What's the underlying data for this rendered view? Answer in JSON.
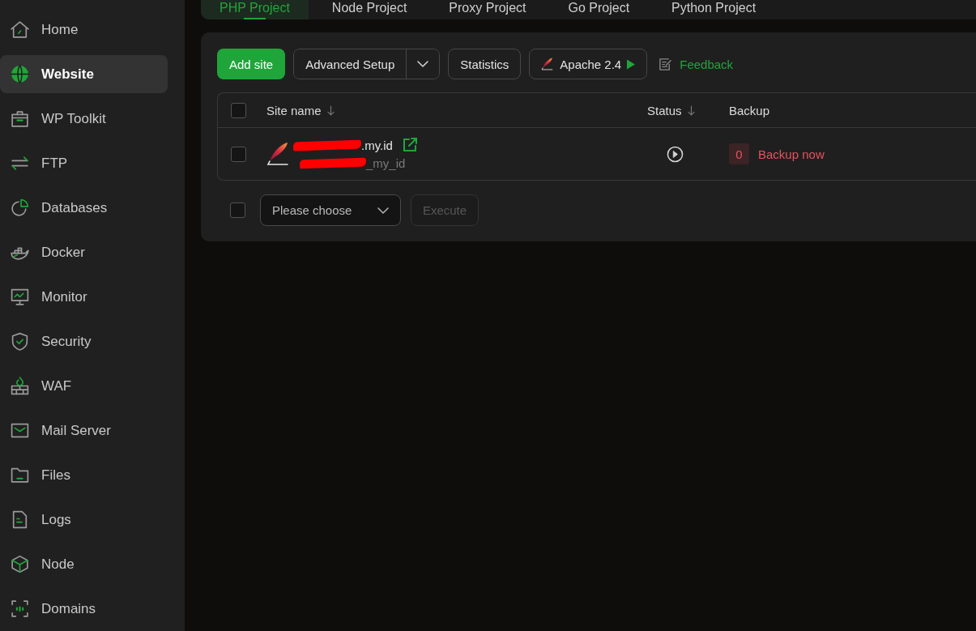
{
  "project_tabs": [
    {
      "label": "PHP Project",
      "selected": true
    },
    {
      "label": "Node Project",
      "selected": false
    },
    {
      "label": "Proxy Project",
      "selected": false
    },
    {
      "label": "Go Project",
      "selected": false
    },
    {
      "label": "Python Project",
      "selected": false
    }
  ],
  "sidebar": {
    "items": [
      {
        "label": "Home",
        "selected": false
      },
      {
        "label": "Website",
        "selected": true
      },
      {
        "label": "WP Toolkit",
        "selected": false
      },
      {
        "label": "FTP",
        "selected": false
      },
      {
        "label": "Databases",
        "selected": false
      },
      {
        "label": "Docker",
        "selected": false
      },
      {
        "label": "Monitor",
        "selected": false
      },
      {
        "label": "Security",
        "selected": false
      },
      {
        "label": "WAF",
        "selected": false
      },
      {
        "label": "Mail Server",
        "selected": false
      },
      {
        "label": "Files",
        "selected": false
      },
      {
        "label": "Logs",
        "selected": false
      },
      {
        "label": "Node",
        "selected": false
      },
      {
        "label": "Domains",
        "selected": false
      }
    ]
  },
  "toolbar": {
    "add_site": "Add site",
    "advanced_setup": "Advanced Setup",
    "statistics": "Statistics",
    "web_server": "Apache 2.4",
    "feedback": "Feedback"
  },
  "table": {
    "select_all": {
      "checked": false
    },
    "columns": [
      {
        "label": "Site name",
        "sortable": true
      },
      {
        "label": "Status",
        "sortable": true
      },
      {
        "label": "Backup",
        "sortable": false
      }
    ],
    "rows": [
      {
        "checked": false,
        "domain": ".my.id",
        "path": "_my_id",
        "backup_count": "0",
        "backup_action": "Backup now"
      }
    ]
  },
  "bulk_actions": {
    "checked": false,
    "select": {
      "placeholder": "Please choose"
    },
    "execute": {
      "label": "Execute",
      "disabled": true
    }
  }
}
